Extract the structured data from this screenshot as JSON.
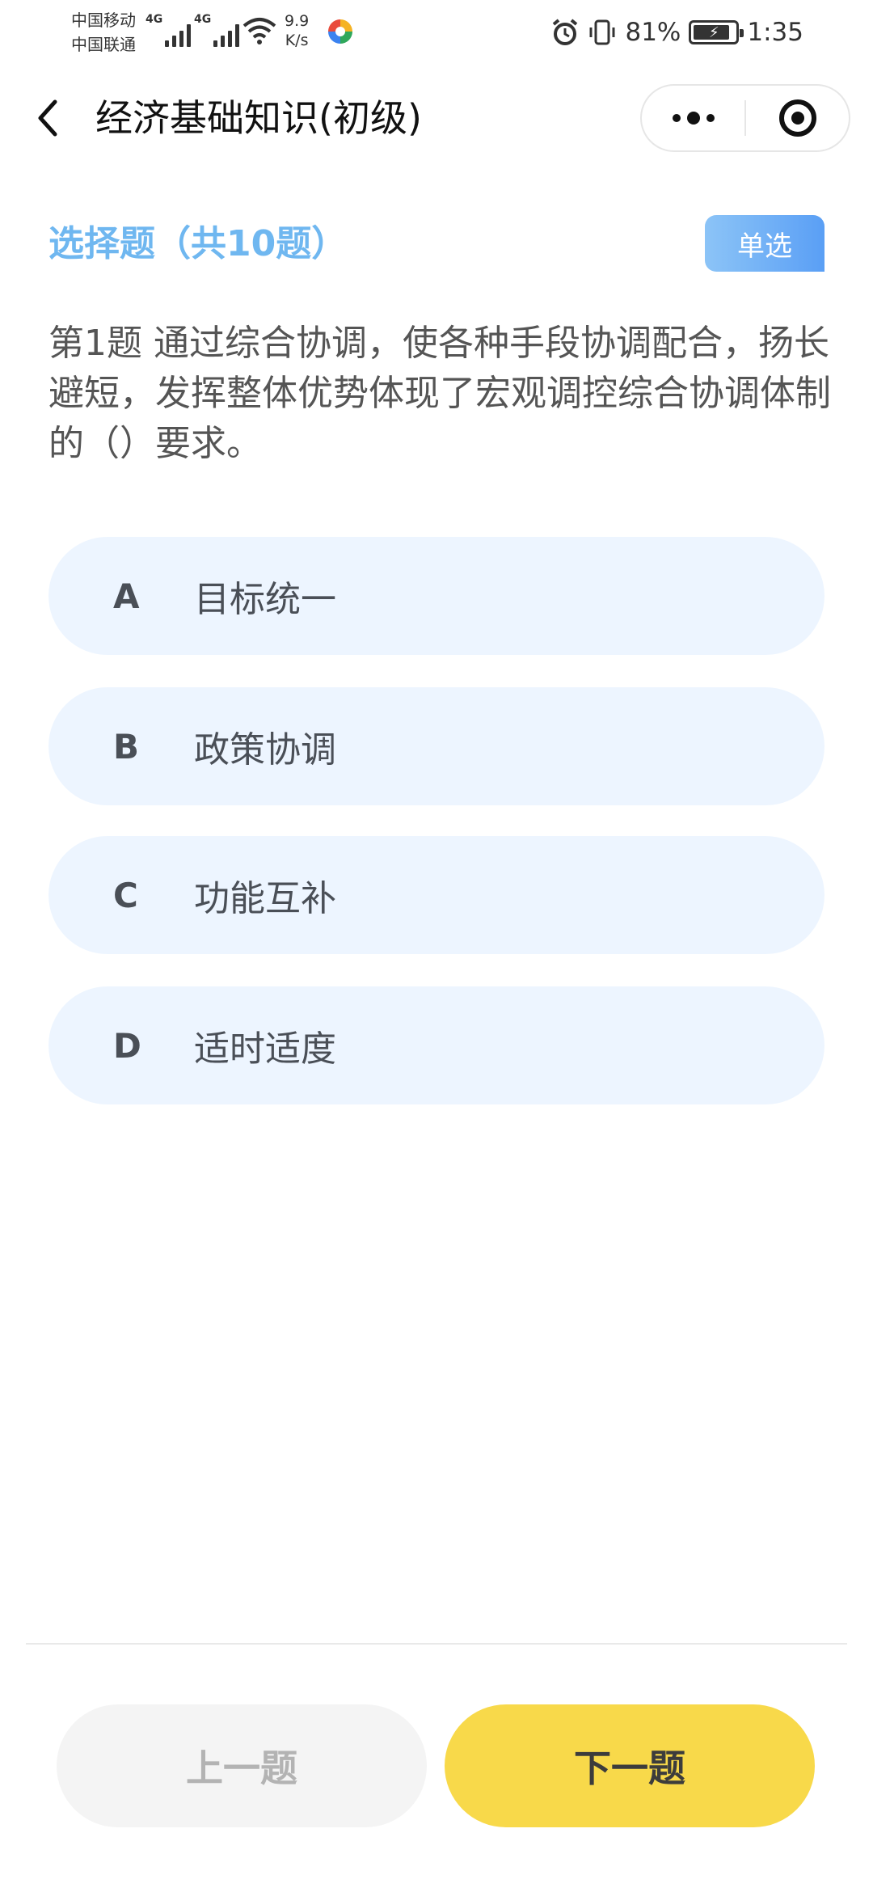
{
  "status_bar": {
    "carrier1": "中国移动",
    "carrier2": "中国联通",
    "net1": "4G",
    "net2": "4G",
    "speed_value": "9.9",
    "speed_unit": "K/s",
    "battery": "81%",
    "time": "1:35",
    "icons": [
      "alarm-icon",
      "vibrate-icon",
      "battery-charging-icon",
      "wifi-icon"
    ]
  },
  "nav": {
    "title": "经济基础知识(初级)",
    "more_icon": "more-dots-icon",
    "close_icon": "target-icon"
  },
  "section": {
    "title": "选择题（共10题）",
    "badge": "单选"
  },
  "question": {
    "text": "第1题 通过综合协调，使各种手段协调配合，扬长避短，发挥整体优势体现了宏观调控综合协调体制的（）要求。"
  },
  "options": [
    {
      "letter": "A",
      "text": "目标统一"
    },
    {
      "letter": "B",
      "text": "政策协调"
    },
    {
      "letter": "C",
      "text": "功能互补"
    },
    {
      "letter": "D",
      "text": "适时适度"
    }
  ],
  "footer": {
    "prev_label": "上一题",
    "next_label": "下一题"
  },
  "colors": {
    "section_title": "#6fb7f0",
    "option_bg": "#edf5ff",
    "next_button": "#f8d94a",
    "prev_button": "#f4f4f4"
  }
}
